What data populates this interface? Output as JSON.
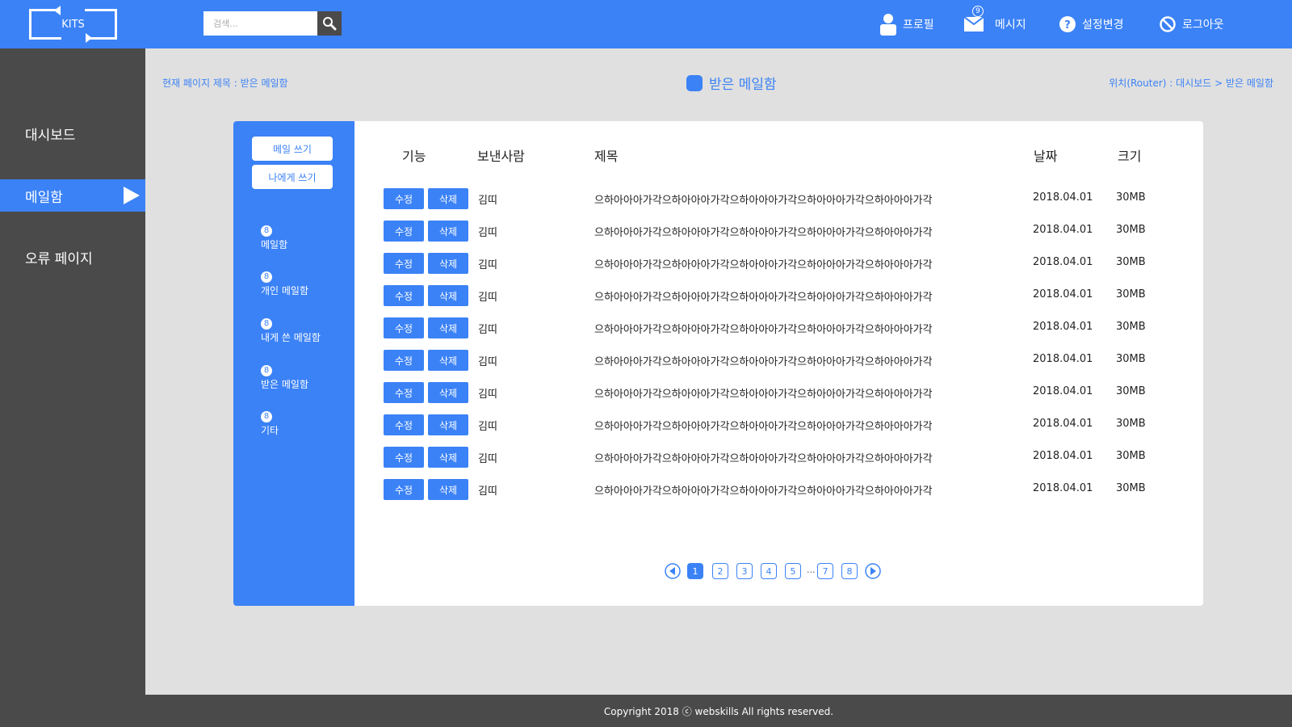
{
  "header": {
    "logo": "KITS",
    "search_placeholder": "검색...",
    "nav": {
      "profile": "프로필",
      "message": "메시지",
      "message_badge": "9",
      "settings": "설정변경",
      "logout": "로그아웃"
    }
  },
  "sidebar": {
    "items": [
      "대시보드",
      "메일함",
      "오류 페이지"
    ],
    "active": "메일함"
  },
  "page": {
    "current_title": "현재 페이지 제목 : 받은 메일함",
    "center_title": "받은 메일함",
    "breadcrumb": "위치(Router) : 대시보드 > 받은 메일함"
  },
  "mail_sidebar": {
    "write_button": "메일 쓰기",
    "write_self_button": "나에게 쓰기",
    "mailboxes": [
      {
        "count": "8",
        "label": "메일함"
      },
      {
        "count": "8",
        "label": "개인 메일함"
      },
      {
        "count": "8",
        "label": "내게 쓴 메일함"
      },
      {
        "count": "8",
        "label": "받은 메일함"
      },
      {
        "count": "8",
        "label": "기타"
      }
    ]
  },
  "table": {
    "headers": {
      "function": "기능",
      "sender": "보낸사람",
      "subject": "제목",
      "date": "날짜",
      "size": "크기"
    },
    "edit_label": "수정",
    "delete_label": "삭제",
    "rows": [
      {
        "sender": "김띠",
        "subject": "으하아아아가각으하아아아가각으하아아아가각으하아아아가각으하아아아가각",
        "date": "2018.04.01",
        "size": "30MB"
      },
      {
        "sender": "김띠",
        "subject": "으하아아아가각으하아아아가각으하아아아가각으하아아아가각으하아아아가각",
        "date": "2018.04.01",
        "size": "30MB"
      },
      {
        "sender": "김띠",
        "subject": "으하아아아가각으하아아아가각으하아아아가각으하아아아가각으하아아아가각",
        "date": "2018.04.01",
        "size": "30MB"
      },
      {
        "sender": "김띠",
        "subject": "으하아아아가각으하아아아가각으하아아아가각으하아아아가각으하아아아가각",
        "date": "2018.04.01",
        "size": "30MB"
      },
      {
        "sender": "김띠",
        "subject": "으하아아아가각으하아아아가각으하아아아가각으하아아아가각으하아아아가각",
        "date": "2018.04.01",
        "size": "30MB"
      },
      {
        "sender": "김띠",
        "subject": "으하아아아가각으하아아아가각으하아아아가각으하아아아가각으하아아아가각",
        "date": "2018.04.01",
        "size": "30MB"
      },
      {
        "sender": "김띠",
        "subject": "으하아아아가각으하아아아가각으하아아아가각으하아아아가각으하아아아가각",
        "date": "2018.04.01",
        "size": "30MB"
      },
      {
        "sender": "김띠",
        "subject": "으하아아아가각으하아아아가각으하아아아가각으하아아아가각으하아아아가각",
        "date": "2018.04.01",
        "size": "30MB"
      },
      {
        "sender": "김띠",
        "subject": "으하아아아가각으하아아아가각으하아아아가각으하아아아가각으하아아아가각",
        "date": "2018.04.01",
        "size": "30MB"
      },
      {
        "sender": "김띠",
        "subject": "으하아아아가각으하아아아가각으하아아아가각으하아아아가각으하아아아가각",
        "date": "2018.04.01",
        "size": "30MB"
      }
    ]
  },
  "pagination": {
    "pages": [
      "1",
      "2",
      "3",
      "4",
      "5",
      "7",
      "8"
    ],
    "ellipsis": "...",
    "current": "1"
  },
  "footer": {
    "copyright": "Copyright 2018 ⓒ webskills All rights reserved."
  },
  "colors": {
    "accent": "#3b82f6",
    "dark": "#4a4a4a",
    "background": "#e0e0e0"
  }
}
